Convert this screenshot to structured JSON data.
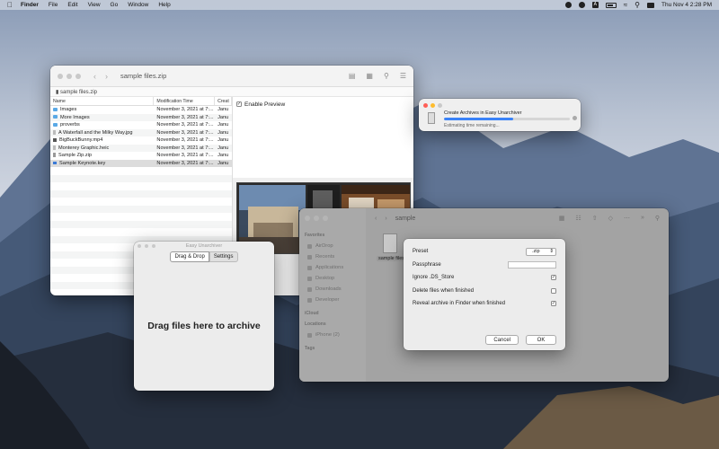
{
  "menubar": {
    "app": "Finder",
    "items": [
      "File",
      "Edit",
      "View",
      "Go",
      "Window",
      "Help"
    ],
    "status_letter": "A",
    "clock": "Thu Nov 4  2:28 PM"
  },
  "zip_window": {
    "title": "sample files.zip",
    "path": "sample files.zip",
    "columns": {
      "name": "Name",
      "modified": "Modification Time",
      "created": "Creat"
    },
    "files": [
      {
        "name": "Images",
        "icon": "folder-icon",
        "modified": "November 3, 2021 at 7:...",
        "created": "Janu"
      },
      {
        "name": "More Images",
        "icon": "folder-icon",
        "modified": "November 3, 2021 at 7:...",
        "created": "Janu"
      },
      {
        "name": "proverbs",
        "icon": "folder-icon",
        "modified": "November 3, 2021 at 7:...",
        "created": "Janu"
      },
      {
        "name": "A Waterfall and the Milky Way.jpg",
        "icon": "image-file-icon",
        "modified": "November 3, 2021 at 7:...",
        "created": "Janu"
      },
      {
        "name": "BigBuckBunny.mp4",
        "icon": "video-file-icon",
        "modified": "November 3, 2021 at 7:...",
        "created": "Janu"
      },
      {
        "name": "Monterey Graphic.heic",
        "icon": "image-file-icon",
        "modified": "November 3, 2021 at 7:...",
        "created": "Janu"
      },
      {
        "name": "Sample Zip.zip",
        "icon": "zip-file-icon",
        "modified": "November 3, 2021 at 7:...",
        "created": "Janu"
      },
      {
        "name": "Sample Keynote.key",
        "icon": "keynote-file-icon",
        "modified": "November 3, 2021 at 7:...",
        "created": "Janu",
        "selected": true
      }
    ],
    "preview_checkbox_label": "Enable Preview",
    "preview_checked": true
  },
  "easy_unarchiver_window": {
    "title": "Easy Unarchiver",
    "tabs": [
      "Drag & Drop",
      "Settings"
    ],
    "active_tab": "Drag & Drop",
    "drop_text": "Drag files here to archive"
  },
  "progress_window": {
    "title": "Create Archives in Easy Unarchiver",
    "status": "Estimating time remaining...",
    "progress": 0.55
  },
  "sample_window": {
    "title": "sample",
    "sidebar": {
      "favorites_header": "Favorites",
      "favorites": [
        "AirDrop",
        "Recents",
        "Applications",
        "Desktop",
        "Downloads",
        "Developer"
      ],
      "icloud_header": "iCloud",
      "locations_header": "Locations",
      "locations": [
        "iPhone (2)"
      ],
      "tags_header": "Tags"
    },
    "file_label": "sample files..."
  },
  "settings_sheet": {
    "preset_label": "Preset",
    "preset_value": ".zip",
    "passphrase_label": "Passphrase",
    "passphrase_value": "",
    "options": [
      {
        "label": "Ignore .DS_Store",
        "checked": true
      },
      {
        "label": "Delete files when finished",
        "checked": false
      },
      {
        "label": "Reveal archive in Finder when finished",
        "checked": true
      }
    ],
    "cancel_label": "Cancel",
    "ok_label": "OK"
  }
}
